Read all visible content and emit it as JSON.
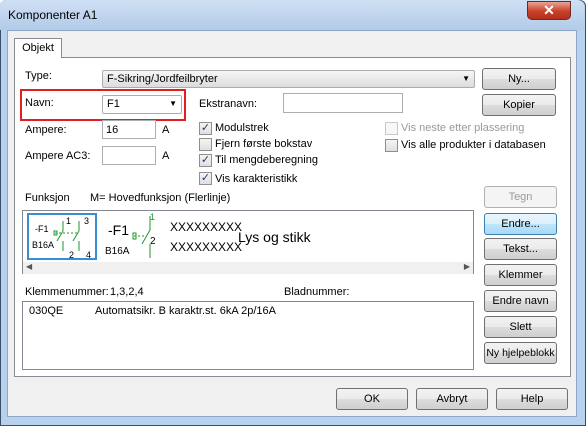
{
  "window": {
    "title": "Komponenter  A1",
    "close_glyph": "✕"
  },
  "tabs": [
    {
      "label": "Objekt"
    }
  ],
  "form": {
    "type_label": "Type:",
    "type_value": "F-Sikring/Jordfeilbryter",
    "navn_label": "Navn:",
    "navn_value": "F1",
    "ekstranavn_label": "Ekstranavn:",
    "ekstranavn_value": "",
    "ampere_label": "Ampere:",
    "ampere_value": "16",
    "ampere_unit": "A",
    "ampere_ac3_label": "Ampere AC3:",
    "ampere_ac3_value": "",
    "ampere_ac3_unit": "A"
  },
  "checkboxes": [
    {
      "label": "Modulstrek",
      "checked": true,
      "enabled": true
    },
    {
      "label": "Fjern første bokstav",
      "checked": false,
      "enabled": true
    },
    {
      "label": "Til mengdeberegning",
      "checked": true,
      "enabled": true
    },
    {
      "label": "Vis karakteristikk",
      "checked": true,
      "enabled": true
    },
    {
      "label": "Vis neste etter plassering",
      "checked": false,
      "enabled": false
    },
    {
      "label": "Vis alle produkter i databasen",
      "checked": false,
      "enabled": true
    }
  ],
  "funksjon": {
    "label": "Funksjon",
    "value": "M= Hovedfunksjon (Flerlinje)",
    "thumb": {
      "ref": "-F1",
      "rating": "B16A",
      "t1": "1",
      "t2": "2",
      "t3": "3",
      "t4": "4"
    },
    "symbol": {
      "ref": "-F1",
      "rating": "B16A",
      "pin_top": "1",
      "pin_bottom": "2",
      "x_line1": "XXXXXXXXX",
      "x_line2": "XXXXXXXXX",
      "description": "Lys og stikk"
    },
    "scroll_left": "◀",
    "scroll_right": "▶"
  },
  "klemmenummer": {
    "label": "Klemmenummer:",
    "value": "1,3,2,4"
  },
  "bladnummer": {
    "label": "Bladnummer:",
    "value": ""
  },
  "product_row": {
    "code": "030QE",
    "description": "Automatsikr. B karaktr.st.  6kA 2p/16A"
  },
  "side_buttons": {
    "ny": "Ny...",
    "kopier": "Kopier",
    "tegn": "Tegn",
    "endre": "Endre...",
    "tekst": "Tekst...",
    "klemmer": "Klemmer",
    "endre_navn": "Endre navn",
    "slett": "Slett",
    "hjelpeblokk": "Ny hjelpeblokk"
  },
  "bottom_buttons": {
    "ok": "OK",
    "avbryt": "Avbryt",
    "help": "Help"
  },
  "icons": {
    "dropdown": "▼",
    "checkmark": "✓"
  }
}
